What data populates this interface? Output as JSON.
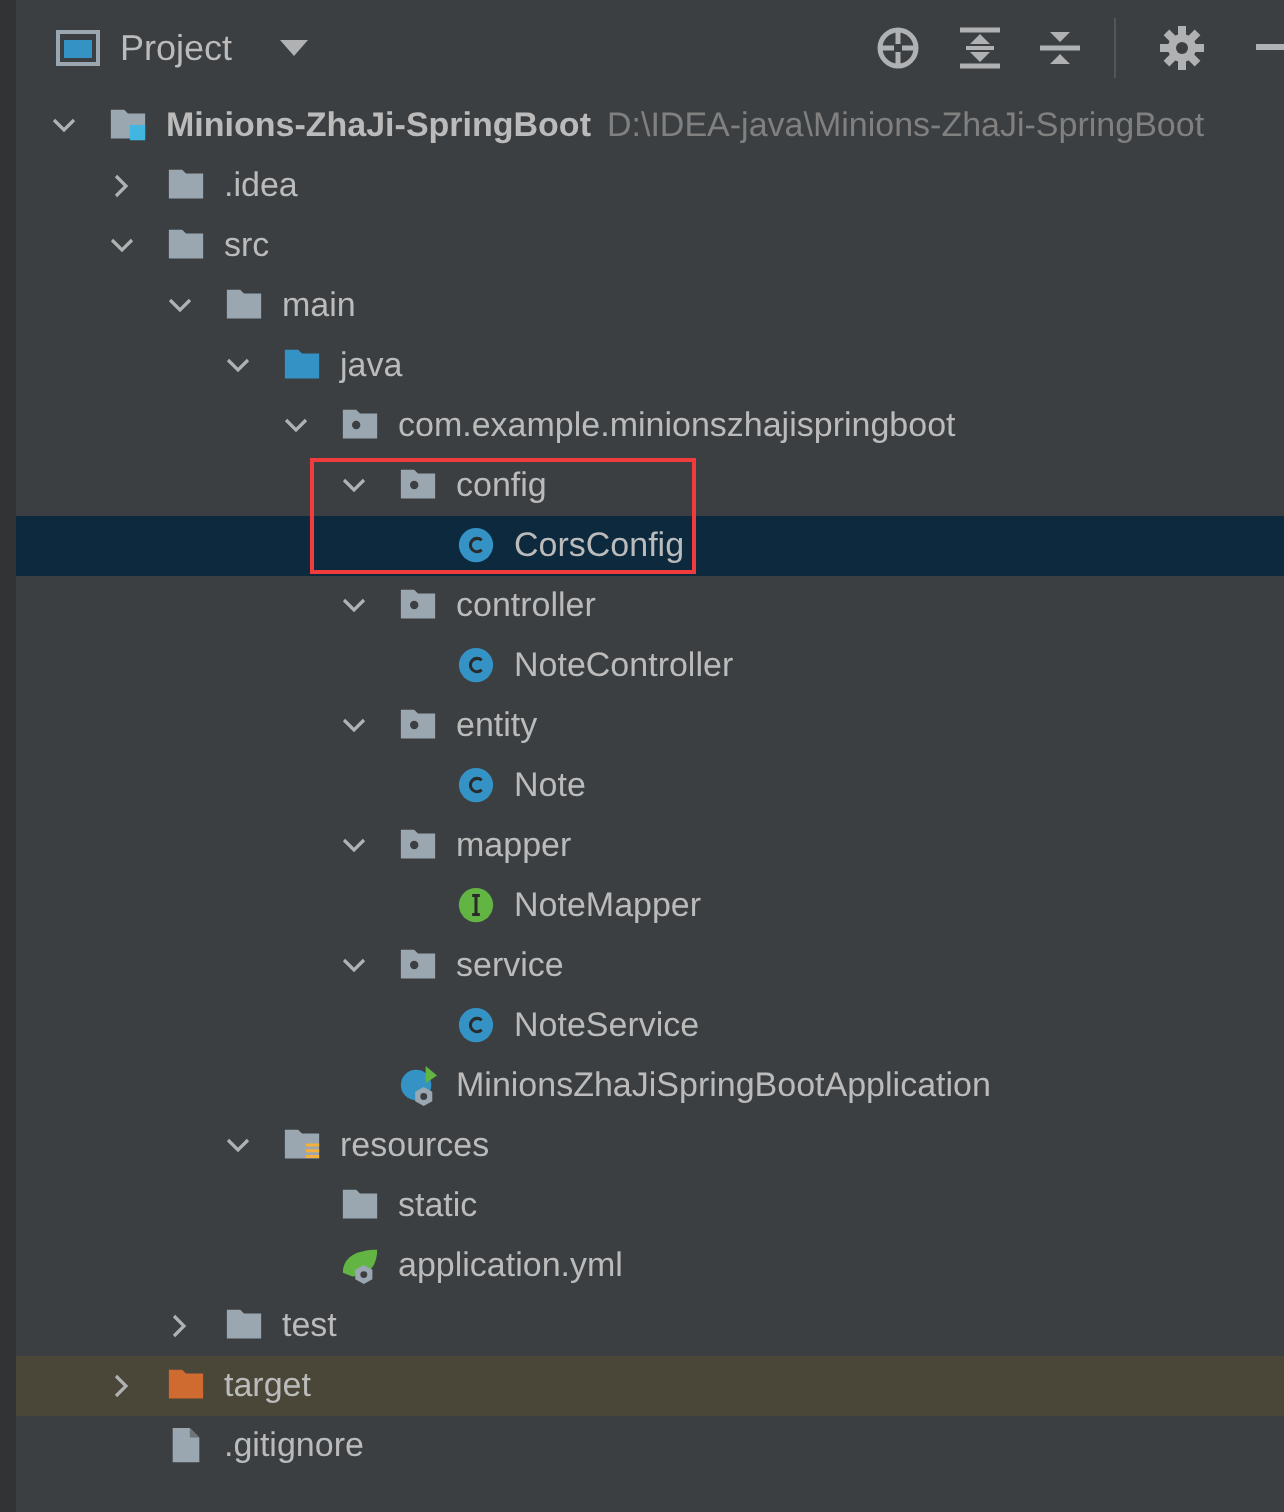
{
  "panel": {
    "title": "Project"
  },
  "tree": [
    {
      "label": "Minions-ZhaJi-SpringBoot",
      "path": "D:\\IDEA-java\\Minions-ZhaJi-SpringBoot",
      "kind": "module",
      "expanded": true,
      "selected": false,
      "highlighted": false,
      "children": [
        {
          "label": ".idea",
          "kind": "folder",
          "expanded": false,
          "selected": false,
          "highlighted": false
        },
        {
          "label": "src",
          "kind": "folder",
          "expanded": true,
          "selected": false,
          "highlighted": false,
          "children": [
            {
              "label": "main",
              "kind": "folder",
              "expanded": true,
              "selected": false,
              "highlighted": false,
              "children": [
                {
                  "label": "java",
                  "kind": "source-folder",
                  "expanded": true,
                  "selected": false,
                  "highlighted": false,
                  "children": [
                    {
                      "label": "com.example.minionszhajispringboot",
                      "kind": "package",
                      "expanded": true,
                      "selected": false,
                      "highlighted": false,
                      "children": [
                        {
                          "label": "config",
                          "kind": "package",
                          "expanded": true,
                          "selected": false,
                          "highlighted": true,
                          "children": [
                            {
                              "label": "CorsConfig",
                              "kind": "class",
                              "selected": true,
                              "highlighted": true
                            }
                          ]
                        },
                        {
                          "label": "controller",
                          "kind": "package",
                          "expanded": true,
                          "selected": false,
                          "highlighted": false,
                          "children": [
                            {
                              "label": "NoteController",
                              "kind": "class",
                              "selected": false,
                              "highlighted": false
                            }
                          ]
                        },
                        {
                          "label": "entity",
                          "kind": "package",
                          "expanded": true,
                          "selected": false,
                          "highlighted": false,
                          "children": [
                            {
                              "label": "Note",
                              "kind": "class",
                              "selected": false,
                              "highlighted": false
                            }
                          ]
                        },
                        {
                          "label": "mapper",
                          "kind": "package",
                          "expanded": true,
                          "selected": false,
                          "highlighted": false,
                          "children": [
                            {
                              "label": "NoteMapper",
                              "kind": "interface",
                              "selected": false,
                              "highlighted": false
                            }
                          ]
                        },
                        {
                          "label": "service",
                          "kind": "package",
                          "expanded": true,
                          "selected": false,
                          "highlighted": false,
                          "children": [
                            {
                              "label": "NoteService",
                              "kind": "class",
                              "selected": false,
                              "highlighted": false
                            }
                          ]
                        },
                        {
                          "label": "MinionsZhaJiSpringBootApplication",
                          "kind": "spring-app",
                          "selected": false,
                          "highlighted": false
                        }
                      ]
                    }
                  ]
                },
                {
                  "label": "resources",
                  "kind": "resources",
                  "expanded": true,
                  "selected": false,
                  "highlighted": false,
                  "children": [
                    {
                      "label": "static",
                      "kind": "folder",
                      "selected": false,
                      "highlighted": false
                    },
                    {
                      "label": "application.yml",
                      "kind": "spring-config",
                      "selected": false,
                      "highlighted": false
                    }
                  ]
                }
              ]
            },
            {
              "label": "test",
              "kind": "folder",
              "expanded": false,
              "selected": false,
              "highlighted": false
            }
          ]
        },
        {
          "label": "target",
          "kind": "excluded",
          "expanded": false,
          "selected": false,
          "highlighted": false
        },
        {
          "label": ".gitignore",
          "kind": "file",
          "selected": false,
          "highlighted": false
        }
      ]
    }
  ]
}
